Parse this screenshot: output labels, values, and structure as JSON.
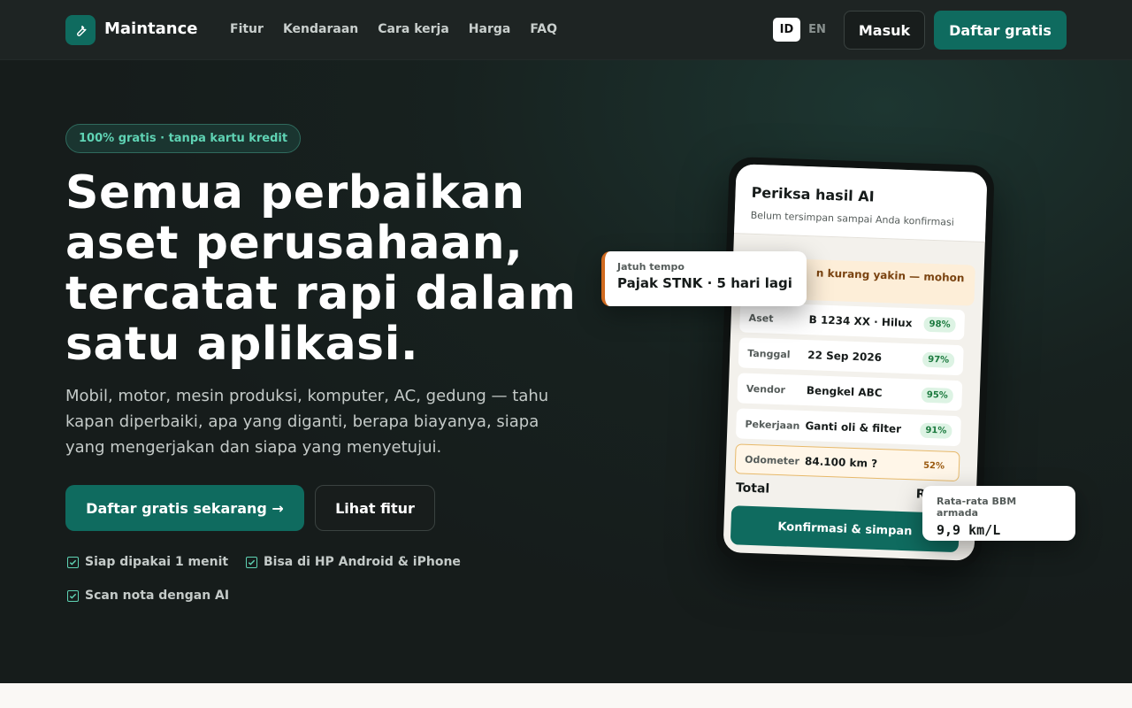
{
  "brand": {
    "name": "Maintance",
    "accent": "#0f6b5f"
  },
  "nav": {
    "links": [
      "Fitur",
      "Kendaraan",
      "Cara kerja",
      "Harga",
      "FAQ"
    ],
    "lang_active": "ID",
    "lang_other": "EN",
    "login_label": "Masuk",
    "signup_label": "Daftar gratis"
  },
  "hero": {
    "badge": "100% gratis · tanpa kartu kredit",
    "headline": "Semua perbaikan aset perusahaan, tercatat rapi dalam satu aplikasi.",
    "subtitle": "Mobil, motor, mesin produksi, komputer, AC, gedung — tahu kapan diperbaiki, apa yang diganti, berapa biayanya, siapa yang mengerjakan dan siapa yang menyetujui.",
    "cta_primary": "Daftar gratis sekarang →",
    "cta_secondary": "Lihat fitur",
    "checks": [
      "Siap dipakai 1 menit",
      "Bisa di HP Android & iPhone",
      "Scan nota dengan AI"
    ]
  },
  "phone": {
    "title": "Periksa hasil AI",
    "subtitle": "Belum tersimpan sampai Anda konfirmasi",
    "warning": "n kurang yakin — mohon",
    "fields": [
      {
        "key": "Aset",
        "value": "B 1234 XX · Hilux",
        "confidence": "98%"
      },
      {
        "key": "Tanggal",
        "value": "22 Sep 2026",
        "confidence": "97%"
      },
      {
        "key": "Vendor",
        "value": "Bengkel ABC",
        "confidence": "95%"
      },
      {
        "key": "Pekerjaan",
        "value": "Ganti oli & filter",
        "confidence": "91%"
      },
      {
        "key": "Odometer",
        "value": "84.100 km ?",
        "confidence": "52%"
      }
    ],
    "total_label": "Total",
    "total_value": "Rp750",
    "confirm_label": "Konfirmasi & simpan"
  },
  "card_due": {
    "label": "Jatuh tempo",
    "value": "Pajak STNK · 5 hari lagi"
  },
  "card_bbm": {
    "label": "Rata-rata BBM armada",
    "value": "9,9 km/L"
  }
}
